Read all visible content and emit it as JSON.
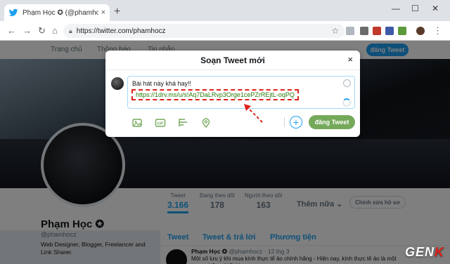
{
  "browser": {
    "tab_title": "Phạm Học ✪ (@phamhocz) | Twi",
    "url": "https://twitter.com/phamhocz"
  },
  "twitter_nav": {
    "home": "Trang chủ",
    "notifications": "Thông báo",
    "messages": "Tin nhắn",
    "tweet_button": "đăng Tweet"
  },
  "profile": {
    "name": "Phạm Học ✪",
    "handle": "@phamhocz",
    "bio": "Web Designer, Blogger, Freelancer and Link Sharer.",
    "stats": [
      {
        "label": "Tweet",
        "value": "3.166"
      },
      {
        "label": "Đang theo dõi",
        "value": "178"
      },
      {
        "label": "Người theo dõi",
        "value": "163"
      }
    ],
    "more": "Thêm nữa",
    "edit_profile": "Chỉnh sửa hồ sơ"
  },
  "stream": {
    "tabs": [
      "Tweet",
      "Tweet & trả lời",
      "Phương tiện"
    ],
    "tweet": {
      "author": "Phạm Học ✪",
      "handle": "@phamhocz",
      "date": "· 12 thg 3",
      "text": "Một số lưu ý khi mua kính thực tế ảo chính hãng - Hiện nay, kính thực tế ảo là một trong những thiết bị..."
    }
  },
  "modal": {
    "title": "Soạn Tweet mới",
    "close": "×",
    "text_line1": "Bài hát này khá hay!!",
    "text_link": "https://1drv.ms/u/s!Aq7DaLRvp3Orge1cePZrREjtL-oqPQ",
    "post_button": "đăng Tweet",
    "add_button": "+"
  },
  "icons": [
    "media-icon",
    "gif-icon",
    "poll-icon",
    "location-icon",
    "emoji-icon",
    "progress-spinner-icon"
  ],
  "colors": {
    "twitter_blue": "#1da1f2",
    "post_green": "#75a95a",
    "link_green": "#2b7a0b",
    "highlight_red": "#e0201a"
  },
  "watermark": {
    "text_a": "GEN",
    "text_b": "K"
  }
}
